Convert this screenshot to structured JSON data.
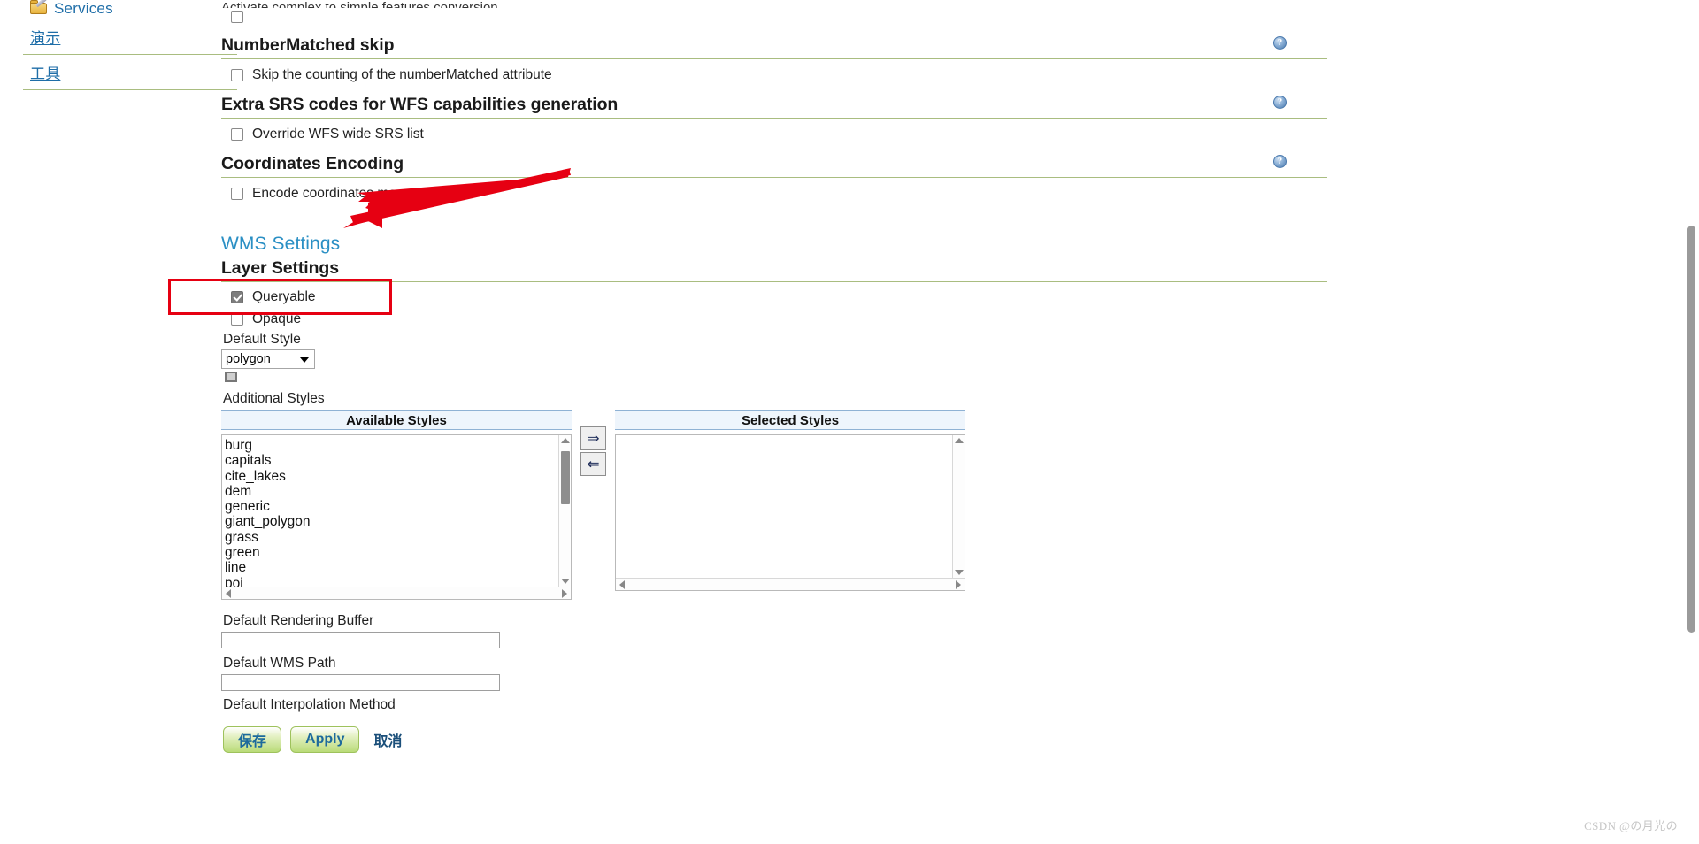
{
  "sidebar": {
    "items": [
      {
        "label": "Services",
        "icon": "folder-pencil-icon",
        "has_icon": true
      },
      {
        "label": "演示",
        "icon": "",
        "has_icon": false
      },
      {
        "label": "工具",
        "icon": "",
        "has_icon": false
      }
    ]
  },
  "main": {
    "cut_off_label": "Activate complex to simple features conversion",
    "sections": [
      {
        "heading": "NumberMatched skip",
        "help_icon": "?",
        "checkbox": {
          "label": "Skip the counting of the numberMatched attribute",
          "checked": false
        }
      },
      {
        "heading": "Extra SRS codes for WFS capabilities generation",
        "help_icon": "?",
        "checkbox": {
          "label": "Override WFS wide SRS list",
          "checked": false
        }
      },
      {
        "heading": "Coordinates Encoding",
        "help_icon": "?",
        "checkbox": {
          "label": "Encode coordinates measures",
          "checked": false
        }
      }
    ],
    "wms": {
      "title": "WMS Settings",
      "layer_settings_heading": "Layer Settings",
      "queryable": {
        "label": "Queryable",
        "checked": true
      },
      "opaque": {
        "label": "Opaque",
        "checked": false
      },
      "default_style": {
        "label": "Default Style",
        "value": "polygon",
        "options": [
          "polygon",
          "burg",
          "capitals",
          "cite_lakes",
          "dem",
          "generic",
          "giant_polygon",
          "grass",
          "green",
          "line",
          "poi"
        ]
      },
      "additional_styles_label": "Additional Styles",
      "available_styles": {
        "header": "Available Styles",
        "items": [
          "burg",
          "capitals",
          "cite_lakes",
          "dem",
          "generic",
          "giant_polygon",
          "grass",
          "green",
          "line",
          "poi"
        ]
      },
      "selected_styles": {
        "header": "Selected Styles",
        "items": []
      },
      "transfer": {
        "add_icon": "⇒",
        "remove_icon": "⇐"
      },
      "rendering_buffer": {
        "label": "Default Rendering Buffer",
        "value": "",
        "placeholder": ""
      },
      "wms_path": {
        "label": "Default WMS Path",
        "value": "",
        "placeholder": ""
      },
      "interpolation_label": "Default Interpolation Method"
    }
  },
  "footer": {
    "save_label": "保存",
    "apply_label": "Apply",
    "cancel_label": "取消"
  },
  "annotations": {
    "arrow_color": "#e60012",
    "rect_color": "#e60012"
  },
  "watermark": "CSDN @の月光の",
  "colors": {
    "link_blue": "#1f6ea8",
    "heading_blue": "#2a8fc4",
    "rule_green": "#a9bd80",
    "panel_blue": "#eef5fc"
  }
}
